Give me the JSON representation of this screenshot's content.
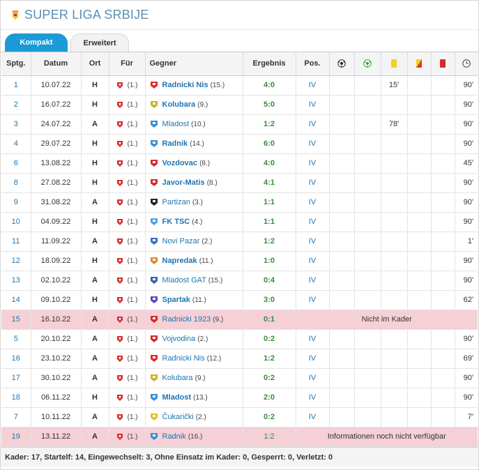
{
  "header": {
    "title": "SUPER LIGA SRBIJE"
  },
  "tabs": [
    {
      "label": "Kompakt"
    },
    {
      "label": "Erweitert"
    }
  ],
  "columns": {
    "spieltag": "Sptg.",
    "datum": "Datum",
    "ort": "Ort",
    "fuer": "Für",
    "gegner": "Gegner",
    "ergebnis": "Ergebnis",
    "pos": "Pos.",
    "icons": [
      "ball-icon",
      "assist-ball-icon",
      "yellow-card-icon",
      "yellow-red-card-icon",
      "red-card-icon",
      "clock-icon"
    ]
  },
  "fuer_rank": "(1.)",
  "rows": [
    {
      "sptg": "1",
      "datum": "10.07.22",
      "ort": "H",
      "gegner": "Radnicki Nis",
      "rank": "(15.)",
      "bold": true,
      "erg": "4:0",
      "pos": "IV",
      "gelb": "15'",
      "minuten": "90'",
      "crest": "#e02b2b"
    },
    {
      "sptg": "2",
      "datum": "16.07.22",
      "ort": "H",
      "gegner": "Kolubara",
      "rank": "(9.)",
      "bold": true,
      "erg": "5:0",
      "pos": "IV",
      "gelb": "",
      "minuten": "90'",
      "crest": "#c8b32a"
    },
    {
      "sptg": "3",
      "datum": "24.07.22",
      "ort": "A",
      "gegner": "Mladost",
      "rank": "(10.)",
      "bold": false,
      "erg": "1:2",
      "pos": "IV",
      "gelb": "78'",
      "minuten": "90'",
      "crest": "#3a8fd0"
    },
    {
      "sptg": "4",
      "datum": "29.07.22",
      "ort": "H",
      "gegner": "Radnik",
      "rank": "(14.)",
      "bold": true,
      "erg": "6:0",
      "pos": "IV",
      "gelb": "",
      "minuten": "90'",
      "crest": "#3a8fd0"
    },
    {
      "sptg": "6",
      "datum": "13.08.22",
      "ort": "H",
      "gegner": "Vozdovac",
      "rank": "(8.)",
      "bold": true,
      "erg": "4:0",
      "pos": "IV",
      "gelb": "",
      "minuten": "45'",
      "crest": "#d42b2b"
    },
    {
      "sptg": "8",
      "datum": "27.08.22",
      "ort": "H",
      "gegner": "Javor-Matis",
      "rank": "(8.)",
      "bold": true,
      "erg": "4:1",
      "pos": "IV",
      "gelb": "",
      "minuten": "90'",
      "crest": "#d42b2b"
    },
    {
      "sptg": "9",
      "datum": "31.08.22",
      "ort": "A",
      "gegner": "Partizan",
      "rank": "(3.)",
      "bold": false,
      "erg": "1:1",
      "pos": "IV",
      "gelb": "",
      "minuten": "90'",
      "crest": "#222222"
    },
    {
      "sptg": "10",
      "datum": "04.09.22",
      "ort": "H",
      "gegner": "FK TSC",
      "rank": "(4.)",
      "bold": true,
      "erg": "1:1",
      "pos": "IV",
      "gelb": "",
      "minuten": "90'",
      "crest": "#5a9ed6"
    },
    {
      "sptg": "11",
      "datum": "11.09.22",
      "ort": "A",
      "gegner": "Novi Pazar",
      "rank": "(2.)",
      "bold": false,
      "erg": "1:2",
      "pos": "IV",
      "gelb": "",
      "minuten": "1'",
      "crest": "#3a6fc0"
    },
    {
      "sptg": "12",
      "datum": "18.09.22",
      "ort": "H",
      "gegner": "Napredak",
      "rank": "(11.)",
      "bold": true,
      "erg": "1:0",
      "pos": "IV",
      "gelb": "",
      "minuten": "90'",
      "crest": "#e08a2b"
    },
    {
      "sptg": "13",
      "datum": "02.10.22",
      "ort": "A",
      "gegner": "Mladost GAT",
      "rank": "(15.)",
      "bold": false,
      "erg": "0:4",
      "pos": "IV",
      "gelb": "",
      "minuten": "90'",
      "crest": "#3a5fb0"
    },
    {
      "sptg": "14",
      "datum": "09.10.22",
      "ort": "H",
      "gegner": "Spartak",
      "rank": "(11.)",
      "bold": true,
      "erg": "3:0",
      "pos": "IV",
      "gelb": "",
      "minuten": "62'",
      "crest": "#5a4ab0"
    },
    {
      "sptg": "15",
      "datum": "16.10.22",
      "ort": "A",
      "gegner": "Radnicki 1923",
      "rank": "(9.)",
      "bold": false,
      "erg": "0:1",
      "pos": "",
      "gelb": "",
      "minuten": "",
      "crest": "#d42b2b",
      "highlight": true,
      "note": "Nicht im Kader"
    },
    {
      "sptg": "5",
      "datum": "20.10.22",
      "ort": "A",
      "gegner": "Vojvodina",
      "rank": "(2.)",
      "bold": false,
      "erg": "0:2",
      "pos": "IV",
      "gelb": "",
      "minuten": "90'",
      "crest": "#d42b2b"
    },
    {
      "sptg": "16",
      "datum": "23.10.22",
      "ort": "A",
      "gegner": "Radnicki Nis",
      "rank": "(12.)",
      "bold": false,
      "erg": "1:2",
      "pos": "IV",
      "gelb": "",
      "minuten": "69'",
      "crest": "#e02b2b"
    },
    {
      "sptg": "17",
      "datum": "30.10.22",
      "ort": "A",
      "gegner": "Kolubara",
      "rank": "(9.)",
      "bold": false,
      "erg": "0:2",
      "pos": "IV",
      "gelb": "",
      "minuten": "90'",
      "crest": "#c8b32a"
    },
    {
      "sptg": "18",
      "datum": "06.11.22",
      "ort": "H",
      "gegner": "Mladost",
      "rank": "(13.)",
      "bold": true,
      "erg": "2:0",
      "pos": "IV",
      "gelb": "",
      "minuten": "90'",
      "crest": "#3a8fd0"
    },
    {
      "sptg": "7",
      "datum": "10.11.22",
      "ort": "A",
      "gegner": "Čukarički",
      "rank": "(2.)",
      "bold": false,
      "erg": "0:2",
      "pos": "IV",
      "gelb": "",
      "minuten": "7'",
      "crest": "#e0c020"
    },
    {
      "sptg": "19",
      "datum": "13.11.22",
      "ort": "A",
      "gegner": "Radnik",
      "rank": "(16.)",
      "bold": false,
      "erg": "1:2",
      "pos": "",
      "gelb": "",
      "minuten": "",
      "crest": "#3a8fd0",
      "highlight": true,
      "note": "Informationen noch nicht verfügbar",
      "draw_style": true
    }
  ],
  "footer": "Kader: 17, Startelf: 14, Eingewechselt: 3, Ohne Einsatz im Kader: 0, Gesperrt: 0, Verletzt: 0"
}
